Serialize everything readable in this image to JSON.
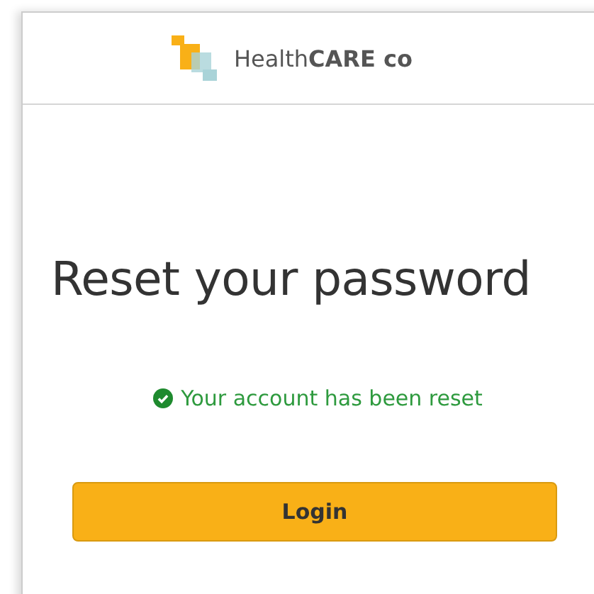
{
  "header": {
    "logo_text": "Health**CARE co**"
  },
  "title": "Reset your password",
  "message": {
    "kind": "success",
    "text": "Your account has been reset"
  },
  "buttons": [
    {
      "label": "Login"
    }
  ]
}
